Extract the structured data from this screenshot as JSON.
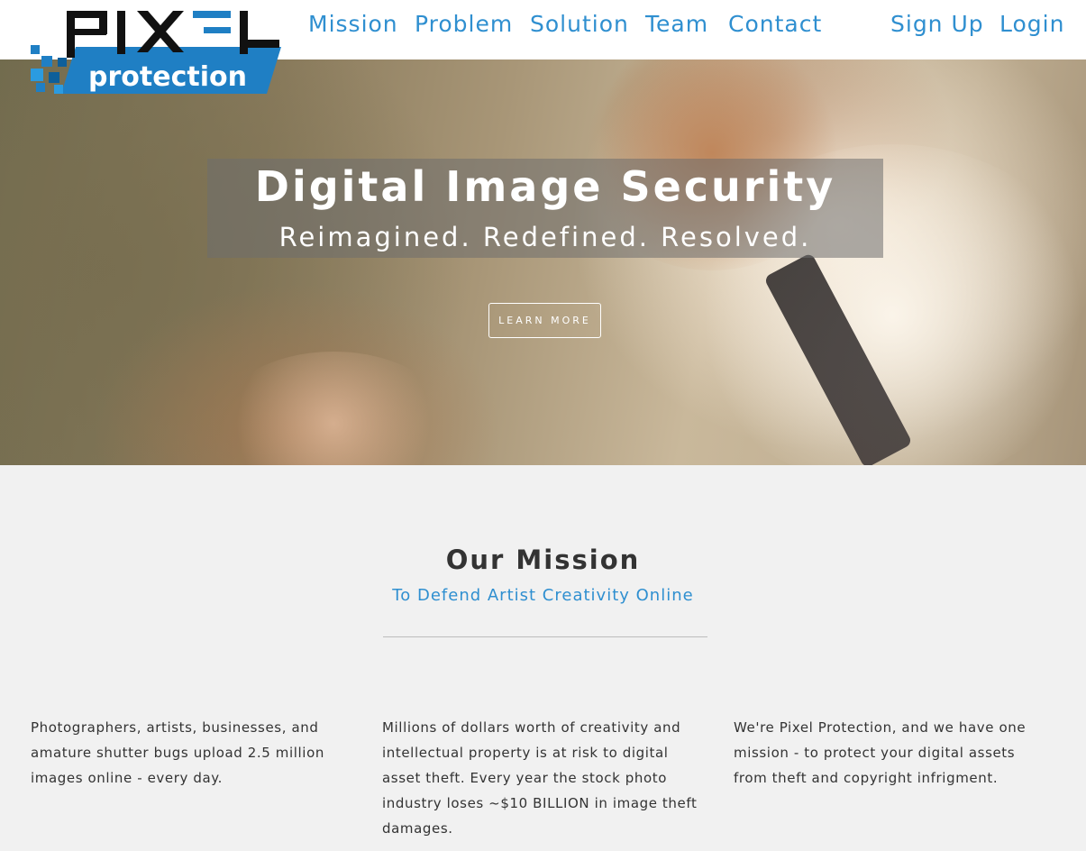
{
  "logo": {
    "word": "PIXEL",
    "tagline": "protection"
  },
  "nav": {
    "links": [
      "Mission",
      "Problem",
      "Solution",
      "Team",
      "Contact"
    ],
    "sign_up": "Sign Up",
    "login": "Login"
  },
  "hero": {
    "title": "Digital Image Security",
    "subtitle": "Reimagined. Redefined. Resolved.",
    "cta": "LEARN MORE"
  },
  "mission": {
    "title": "Our Mission",
    "subtitle": "To Defend Artist Creativity Online",
    "columns": [
      "Photographers, artists, businesses, and amature shutter bugs upload 2.5 million images online - every day.",
      "Millions of dollars worth of creativity and intellectual property is at risk to digital asset theft. Every year the stock photo industry loses ~$10 BILLION in image theft damages.",
      "We're Pixel Protection, and we have one mission - to protect your digital assets from theft and copyright infrigment."
    ]
  },
  "colors": {
    "accent": "#2f8fd0",
    "logo_blue": "#1f7fc4",
    "logo_dark": "#111111",
    "page_bg": "#f1f1f1"
  }
}
